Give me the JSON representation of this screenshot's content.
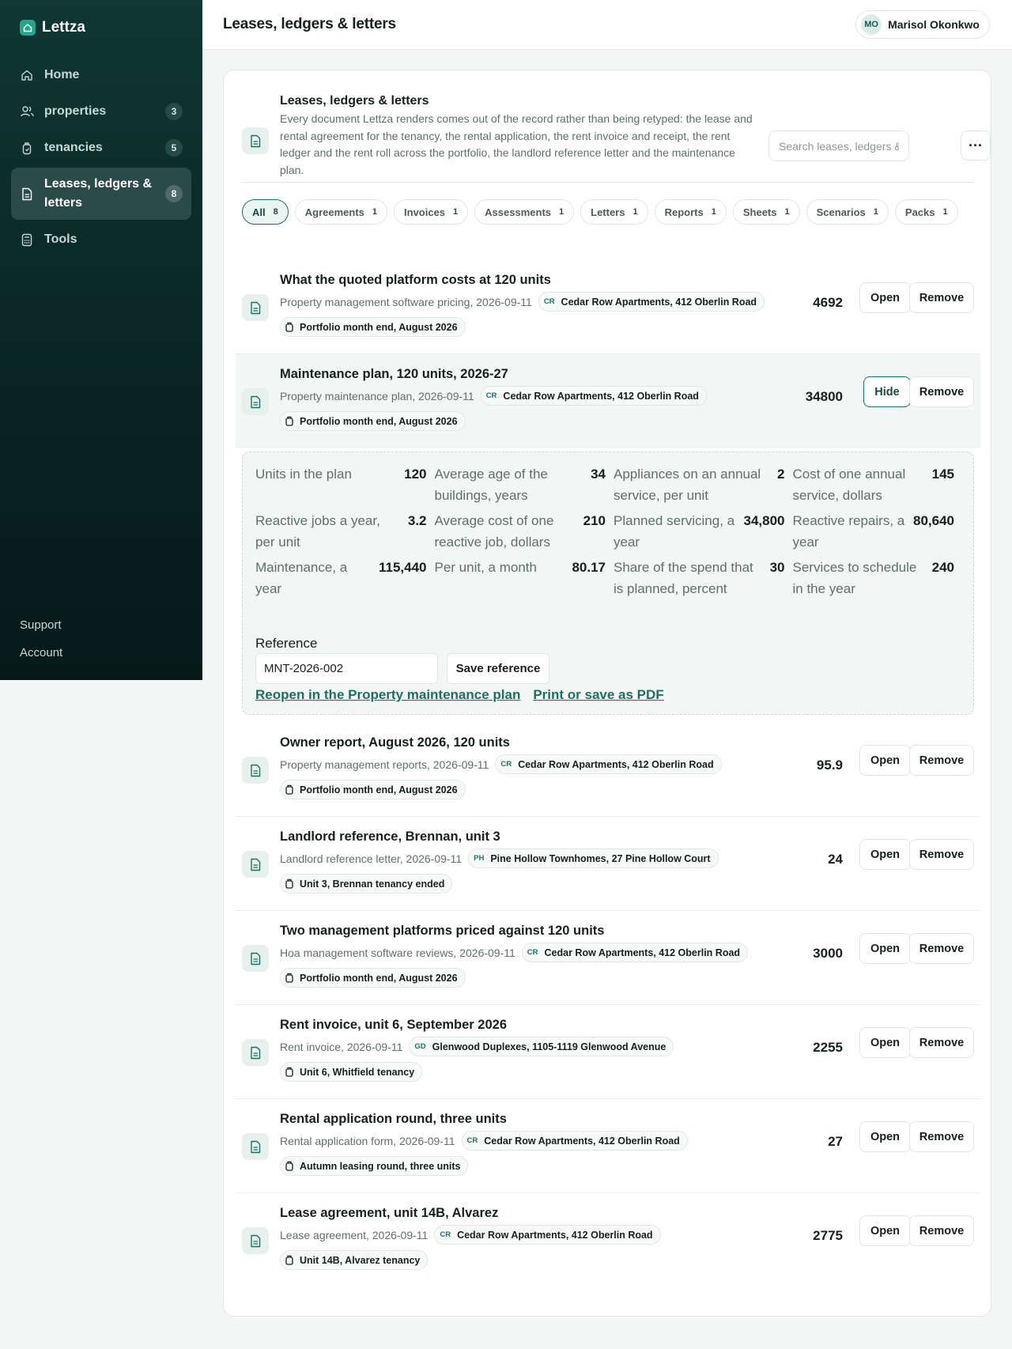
{
  "app": {
    "name": "Lettza"
  },
  "sidebar": {
    "items": [
      {
        "label": "Home",
        "count": ""
      },
      {
        "label": "properties",
        "count": "3"
      },
      {
        "label": "tenancies",
        "count": "5"
      },
      {
        "label": "Leases, ledgers & letters",
        "count": "8"
      },
      {
        "label": "Tools",
        "count": ""
      }
    ],
    "footer": {
      "support": "Support",
      "account": "Account"
    }
  },
  "header": {
    "title": "Leases, ledgers & letters",
    "user": {
      "initials": "MO",
      "name": "Marisol Okonkwo"
    }
  },
  "card": {
    "title": "Leases, ledgers & letters",
    "description": "Every document Lettza renders comes out of the record rather than being retyped: the lease and rental agreement for the tenancy, the rental application, the rent invoice and receipt, the rent ledger and the rent roll across the portfolio, the landlord reference letter and the maintenance plan.",
    "search_placeholder": "Search leases, ledgers & letters",
    "more": "···"
  },
  "filters": [
    {
      "label": "All",
      "count": "8"
    },
    {
      "label": "Agreements",
      "count": "1"
    },
    {
      "label": "Invoices",
      "count": "1"
    },
    {
      "label": "Assessments",
      "count": "1"
    },
    {
      "label": "Letters",
      "count": "1"
    },
    {
      "label": "Reports",
      "count": "1"
    },
    {
      "label": "Sheets",
      "count": "1"
    },
    {
      "label": "Scenarios",
      "count": "1"
    },
    {
      "label": "Packs",
      "count": "1"
    }
  ],
  "actions": {
    "open": "Open",
    "remove": "Remove",
    "hide": "Hide"
  },
  "documents": [
    {
      "title": "What the quoted platform costs at 120 units",
      "meta": "Property management software pricing, 2026-09-11",
      "prop_abbr": "CR",
      "property": "Cedar Row Apartments, 412 Oberlin Road",
      "context": "Portfolio month end, August 2026",
      "value": "4692"
    },
    {
      "title": "Maintenance plan, 120 units, 2026-27",
      "meta": "Property maintenance plan, 2026-09-11",
      "prop_abbr": "CR",
      "property": "Cedar Row Apartments, 412 Oberlin Road",
      "context": "Portfolio month end, August 2026",
      "value": "34800"
    },
    {
      "title": "Owner report, August 2026, 120 units",
      "meta": "Property management reports, 2026-09-11",
      "prop_abbr": "CR",
      "property": "Cedar Row Apartments, 412 Oberlin Road",
      "context": "Portfolio month end, August 2026",
      "value": "95.9"
    },
    {
      "title": "Landlord reference, Brennan, unit 3",
      "meta": "Landlord reference letter, 2026-09-11",
      "prop_abbr": "PH",
      "property": "Pine Hollow Townhomes, 27 Pine Hollow Court",
      "context": "Unit 3, Brennan tenancy ended",
      "value": "24"
    },
    {
      "title": "Two management platforms priced against 120 units",
      "meta": "Hoa management software reviews, 2026-09-11",
      "prop_abbr": "CR",
      "property": "Cedar Row Apartments, 412 Oberlin Road",
      "context": "Portfolio month end, August 2026",
      "value": "3000"
    },
    {
      "title": "Rent invoice, unit 6, September 2026",
      "meta": "Rent invoice, 2026-09-11",
      "prop_abbr": "GD",
      "property": "Glenwood Duplexes, 1105-1119 Glenwood Avenue",
      "context": "Unit 6, Whitfield tenancy",
      "value": "2255"
    },
    {
      "title": "Rental application round, three units",
      "meta": "Rental application form, 2026-09-11",
      "prop_abbr": "CR",
      "property": "Cedar Row Apartments, 412 Oberlin Road",
      "context": "Autumn leasing round, three units",
      "value": "27"
    },
    {
      "title": "Lease agreement, unit 14B, Alvarez",
      "meta": "Lease agreement, 2026-09-11",
      "prop_abbr": "CR",
      "property": "Cedar Row Apartments, 412 Oberlin Road",
      "context": "Unit 14B, Alvarez tenancy",
      "value": "2775"
    }
  ],
  "detail": {
    "metrics": [
      {
        "label": "Units in the plan",
        "value": "120"
      },
      {
        "label": "Average age of the buildings, years",
        "value": "34"
      },
      {
        "label": "Appliances on an annual service, per unit",
        "value": "2"
      },
      {
        "label": "Cost of one annual service, dollars",
        "value": "145"
      },
      {
        "label": "Reactive jobs a year, per unit",
        "value": "3.2"
      },
      {
        "label": "Average cost of one reactive job, dollars",
        "value": "210"
      },
      {
        "label": "Planned servicing, a year",
        "value": "34,800"
      },
      {
        "label": "Reactive repairs, a year",
        "value": "80,640"
      },
      {
        "label": "Maintenance, a year",
        "value": "115,440"
      },
      {
        "label": "Per unit, a month",
        "value": "80.17"
      },
      {
        "label": "Share of the spend that is planned, percent",
        "value": "30"
      },
      {
        "label": "Services to schedule in the year",
        "value": "240"
      }
    ],
    "reference_label": "Reference",
    "reference_value": "MNT-2026-002",
    "save_reference": "Save reference",
    "link_reopen": "Reopen in the Property maintenance plan",
    "link_print": "Print or save as PDF"
  }
}
